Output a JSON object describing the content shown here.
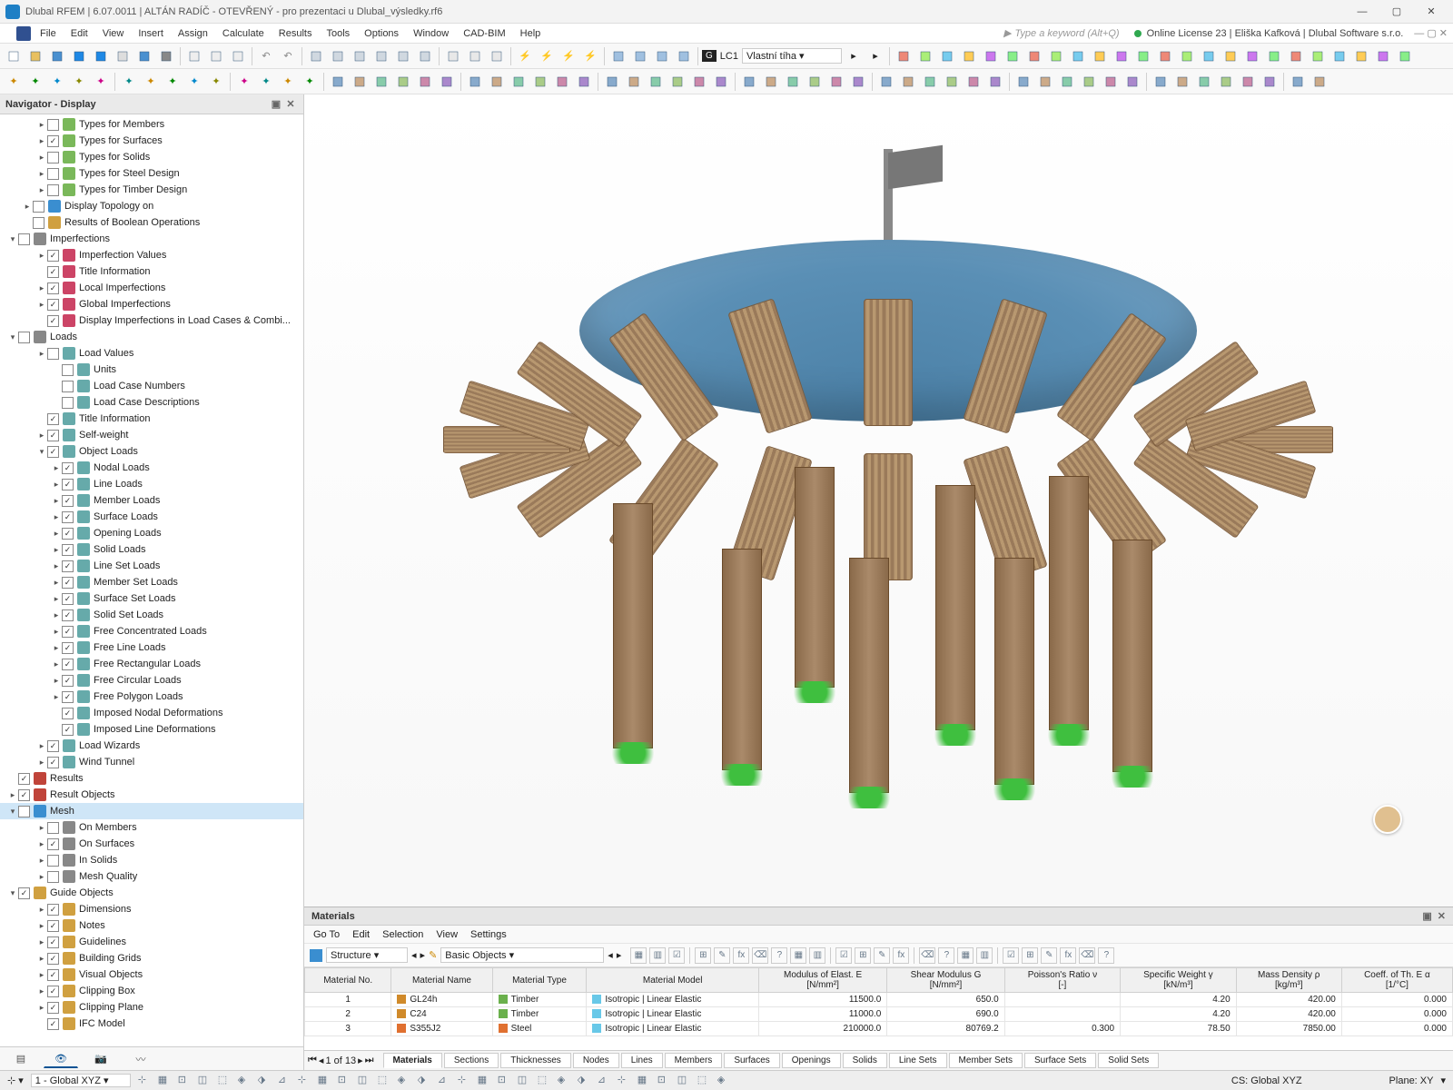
{
  "title": "Dlubal RFEM | 6.07.0011 | ALTÁN RADÍČ - OTEVŘENÝ - pro prezentaci u Dlubal_výsledky.rf6",
  "search_placeholder": "Type a keyword (Alt+Q)",
  "license_text": "Online License 23 | Eliška Kafková | Dlubal Software s.r.o.",
  "menus": [
    "File",
    "Edit",
    "View",
    "Insert",
    "Assign",
    "Calculate",
    "Results",
    "Tools",
    "Options",
    "Window",
    "CAD-BIM",
    "Help"
  ],
  "loadcase": {
    "tag": "G",
    "code": "LC1",
    "name": "Vlastní tíha"
  },
  "nav": {
    "title": "Navigator - Display",
    "items": [
      {
        "d": 2,
        "ar": ">",
        "chk": false,
        "ico": "#7ab85a",
        "lbl": "Types for Members"
      },
      {
        "d": 2,
        "ar": ">",
        "chk": true,
        "ico": "#7ab85a",
        "lbl": "Types for Surfaces"
      },
      {
        "d": 2,
        "ar": ">",
        "chk": false,
        "ico": "#7ab85a",
        "lbl": "Types for Solids"
      },
      {
        "d": 2,
        "ar": ">",
        "chk": false,
        "ico": "#7ab85a",
        "lbl": "Types for Steel Design"
      },
      {
        "d": 2,
        "ar": ">",
        "chk": false,
        "ico": "#7ab85a",
        "lbl": "Types for Timber Design"
      },
      {
        "d": 1,
        "ar": ">",
        "chk": false,
        "ico": "#3a8ed0",
        "lbl": "Display Topology on"
      },
      {
        "d": 1,
        "ar": "",
        "chk": false,
        "ico": "#d0a040",
        "lbl": "Results of Boolean Operations"
      },
      {
        "d": 0,
        "ar": "v",
        "chk": false,
        "ico": "#888",
        "lbl": "Imperfections"
      },
      {
        "d": 2,
        "ar": ">",
        "chk": true,
        "ico": "#c46",
        "lbl": "Imperfection Values"
      },
      {
        "d": 2,
        "ar": "",
        "chk": true,
        "ico": "#c46",
        "lbl": "Title Information"
      },
      {
        "d": 2,
        "ar": ">",
        "chk": true,
        "ico": "#c46",
        "lbl": "Local Imperfections"
      },
      {
        "d": 2,
        "ar": ">",
        "chk": true,
        "ico": "#c46",
        "lbl": "Global Imperfections"
      },
      {
        "d": 2,
        "ar": "",
        "chk": true,
        "ico": "#c46",
        "lbl": "Display Imperfections in Load Cases & Combi..."
      },
      {
        "d": 0,
        "ar": "v",
        "chk": false,
        "ico": "#888",
        "lbl": "Loads"
      },
      {
        "d": 2,
        "ar": ">",
        "chk": false,
        "ico": "#6aa",
        "lbl": "Load Values"
      },
      {
        "d": 3,
        "ar": "",
        "chk": false,
        "ico": "#6aa",
        "lbl": "Units"
      },
      {
        "d": 3,
        "ar": "",
        "chk": false,
        "ico": "#6aa",
        "lbl": "Load Case Numbers"
      },
      {
        "d": 3,
        "ar": "",
        "chk": false,
        "ico": "#6aa",
        "lbl": "Load Case Descriptions"
      },
      {
        "d": 2,
        "ar": "",
        "chk": true,
        "ico": "#6aa",
        "lbl": "Title Information"
      },
      {
        "d": 2,
        "ar": ">",
        "chk": true,
        "ico": "#6aa",
        "lbl": "Self-weight"
      },
      {
        "d": 2,
        "ar": "v",
        "chk": true,
        "ico": "#6aa",
        "lbl": "Object Loads"
      },
      {
        "d": 3,
        "ar": ">",
        "chk": true,
        "ico": "#6aa",
        "lbl": "Nodal Loads"
      },
      {
        "d": 3,
        "ar": ">",
        "chk": true,
        "ico": "#6aa",
        "lbl": "Line Loads"
      },
      {
        "d": 3,
        "ar": ">",
        "chk": true,
        "ico": "#6aa",
        "lbl": "Member Loads"
      },
      {
        "d": 3,
        "ar": ">",
        "chk": true,
        "ico": "#6aa",
        "lbl": "Surface Loads"
      },
      {
        "d": 3,
        "ar": ">",
        "chk": true,
        "ico": "#6aa",
        "lbl": "Opening Loads"
      },
      {
        "d": 3,
        "ar": ">",
        "chk": true,
        "ico": "#6aa",
        "lbl": "Solid Loads"
      },
      {
        "d": 3,
        "ar": ">",
        "chk": true,
        "ico": "#6aa",
        "lbl": "Line Set Loads"
      },
      {
        "d": 3,
        "ar": ">",
        "chk": true,
        "ico": "#6aa",
        "lbl": "Member Set Loads"
      },
      {
        "d": 3,
        "ar": ">",
        "chk": true,
        "ico": "#6aa",
        "lbl": "Surface Set Loads"
      },
      {
        "d": 3,
        "ar": ">",
        "chk": true,
        "ico": "#6aa",
        "lbl": "Solid Set Loads"
      },
      {
        "d": 3,
        "ar": ">",
        "chk": true,
        "ico": "#6aa",
        "lbl": "Free Concentrated Loads"
      },
      {
        "d": 3,
        "ar": ">",
        "chk": true,
        "ico": "#6aa",
        "lbl": "Free Line Loads"
      },
      {
        "d": 3,
        "ar": ">",
        "chk": true,
        "ico": "#6aa",
        "lbl": "Free Rectangular Loads"
      },
      {
        "d": 3,
        "ar": ">",
        "chk": true,
        "ico": "#6aa",
        "lbl": "Free Circular Loads"
      },
      {
        "d": 3,
        "ar": ">",
        "chk": true,
        "ico": "#6aa",
        "lbl": "Free Polygon Loads"
      },
      {
        "d": 3,
        "ar": "",
        "chk": true,
        "ico": "#6aa",
        "lbl": "Imposed Nodal Deformations"
      },
      {
        "d": 3,
        "ar": "",
        "chk": true,
        "ico": "#6aa",
        "lbl": "Imposed Line Deformations"
      },
      {
        "d": 2,
        "ar": ">",
        "chk": true,
        "ico": "#6aa",
        "lbl": "Load Wizards"
      },
      {
        "d": 2,
        "ar": ">",
        "chk": true,
        "ico": "#6aa",
        "lbl": "Wind Tunnel"
      },
      {
        "d": 0,
        "ar": "",
        "chk": true,
        "ico": "#c0443a",
        "lbl": "Results"
      },
      {
        "d": 0,
        "ar": ">",
        "chk": true,
        "ico": "#c0443a",
        "lbl": "Result Objects"
      },
      {
        "d": 0,
        "ar": "v",
        "chk": false,
        "ico": "#3a8ed0",
        "lbl": "Mesh",
        "sel": true
      },
      {
        "d": 2,
        "ar": ">",
        "chk": false,
        "ico": "#888",
        "lbl": "On Members"
      },
      {
        "d": 2,
        "ar": ">",
        "chk": true,
        "ico": "#888",
        "lbl": "On Surfaces"
      },
      {
        "d": 2,
        "ar": ">",
        "chk": false,
        "ico": "#888",
        "lbl": "In Solids"
      },
      {
        "d": 2,
        "ar": ">",
        "chk": false,
        "ico": "#888",
        "lbl": "Mesh Quality"
      },
      {
        "d": 0,
        "ar": "v",
        "chk": true,
        "ico": "#d0a040",
        "lbl": "Guide Objects"
      },
      {
        "d": 2,
        "ar": ">",
        "chk": true,
        "ico": "#d0a040",
        "lbl": "Dimensions"
      },
      {
        "d": 2,
        "ar": ">",
        "chk": true,
        "ico": "#d0a040",
        "lbl": "Notes"
      },
      {
        "d": 2,
        "ar": ">",
        "chk": true,
        "ico": "#d0a040",
        "lbl": "Guidelines"
      },
      {
        "d": 2,
        "ar": ">",
        "chk": true,
        "ico": "#d0a040",
        "lbl": "Building Grids"
      },
      {
        "d": 2,
        "ar": ">",
        "chk": true,
        "ico": "#d0a040",
        "lbl": "Visual Objects"
      },
      {
        "d": 2,
        "ar": ">",
        "chk": true,
        "ico": "#d0a040",
        "lbl": "Clipping Box"
      },
      {
        "d": 2,
        "ar": ">",
        "chk": true,
        "ico": "#d0a040",
        "lbl": "Clipping Plane"
      },
      {
        "d": 2,
        "ar": "",
        "chk": true,
        "ico": "#d0a040",
        "lbl": "IFC Model"
      }
    ]
  },
  "materials": {
    "title": "Materials",
    "menus": [
      "Go To",
      "Edit",
      "Selection",
      "View",
      "Settings"
    ],
    "structure_label": "Structure",
    "basic_label": "Basic Objects",
    "headers1": [
      "Material No.",
      "Material Name",
      "Material Type",
      "Material Model",
      "Modulus of Elast. E [N/mm²]",
      "Shear Modulus G [N/mm²]",
      "Poisson's Ratio ν [-]",
      "Specific Weight γ [kN/m³]",
      "Mass Density ρ [kg/m³]",
      "Coeff. of Th. E α [1/°C]"
    ],
    "rows": [
      {
        "no": "1",
        "name": "GL24h",
        "sw": "#d08a2a",
        "type": "Timber",
        "tsw": "#6ab04c",
        "model": "Isotropic | Linear Elastic",
        "msw": "#68c8e8",
        "e": "11500.0",
        "g": "650.0",
        "v": "",
        "y": "4.20",
        "p": "420.00",
        "a": "0.000"
      },
      {
        "no": "2",
        "name": "C24",
        "sw": "#d08a2a",
        "type": "Timber",
        "tsw": "#6ab04c",
        "model": "Isotropic | Linear Elastic",
        "msw": "#68c8e8",
        "e": "11000.0",
        "g": "690.0",
        "v": "",
        "y": "4.20",
        "p": "420.00",
        "a": "0.000"
      },
      {
        "no": "3",
        "name": "S355J2",
        "sw": "#e07030",
        "type": "Steel",
        "tsw": "#e07030",
        "model": "Isotropic | Linear Elastic",
        "msw": "#68c8e8",
        "e": "210000.0",
        "g": "80769.2",
        "v": "0.300",
        "y": "78.50",
        "p": "7850.00",
        "a": "0.000"
      }
    ],
    "page": "1 of 13",
    "tabs": [
      "Materials",
      "Sections",
      "Thicknesses",
      "Nodes",
      "Lines",
      "Members",
      "Surfaces",
      "Openings",
      "Solids",
      "Line Sets",
      "Member Sets",
      "Surface Sets",
      "Solid Sets"
    ]
  },
  "status": {
    "cs": "CS: Global XYZ",
    "plane": "Plane: XY",
    "coordsys": "1 - Global XYZ"
  }
}
